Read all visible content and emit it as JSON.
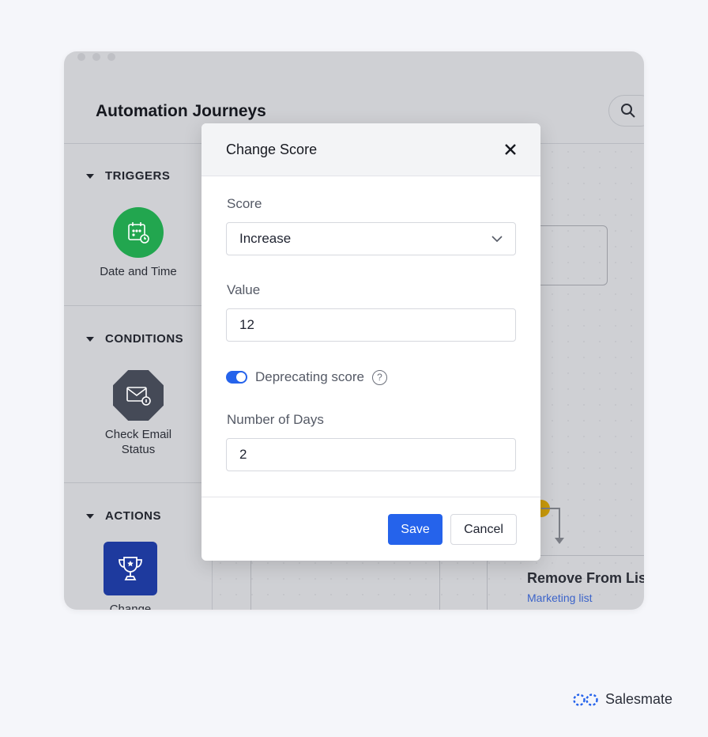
{
  "app": {
    "title": "Automation Journeys"
  },
  "sidebar": {
    "sections": [
      {
        "title": "TRIGGERS",
        "item": "Date and Time",
        "color": "#22a64f"
      },
      {
        "title": "CONDITIONS",
        "item_lines": [
          "Check Email",
          "Status"
        ],
        "color": "#454a57"
      },
      {
        "title": "ACTIONS",
        "item": "Change",
        "color": "#1e3a9e"
      }
    ]
  },
  "canvas": {
    "node_title": "Remove From List",
    "node_subtitle": "Marketing list"
  },
  "modal": {
    "title": "Change Score",
    "score_label": "Score",
    "score_value": "Increase",
    "value_label": "Value",
    "value": "12",
    "toggle_label": "Deprecating score",
    "toggle_on": true,
    "days_label": "Number of Days",
    "days": "2",
    "save": "Save",
    "cancel": "Cancel"
  },
  "brand": {
    "name": "Salesmate",
    "accent": "#2563eb"
  }
}
